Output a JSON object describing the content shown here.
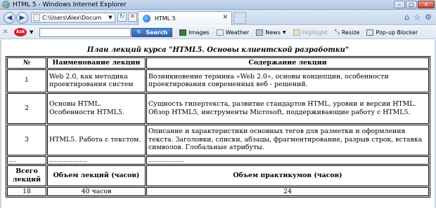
{
  "window": {
    "title": "HTML 5 - Windows Internet Explorer",
    "controls": {
      "minimize": "–",
      "maximize": "□",
      "close": "✕"
    }
  },
  "navbar": {
    "address": "C:\\Users\\Alex\\Docum",
    "tab_label": "HTML 5"
  },
  "toolbar": {
    "logo": "Ask",
    "search_button": "Search",
    "items": [
      {
        "label": "Images",
        "icon": "images-icon"
      },
      {
        "label": "Weather",
        "icon": "weather-icon"
      },
      {
        "label": "News",
        "icon": "news-icon"
      },
      {
        "label": "Highlight",
        "icon": "highlight-icon"
      },
      {
        "label": "Resize",
        "icon": "resize-icon"
      },
      {
        "label": "Pop-up Blocker",
        "icon": "popup-blocker-icon"
      }
    ]
  },
  "document": {
    "caption": "План лекций курса \"HTML5. Основы клиентской разработки\"",
    "headers": {
      "num": "№",
      "name": "Наименование лекции",
      "desc": "Содержание лекции"
    },
    "rows": [
      {
        "num": "1",
        "name": "Web 2.0, как методика проектирования систем",
        "desc": "Возникновение термина «Web 2.0», основы концепции, особенности проектирования современных веб - решений."
      },
      {
        "num": "2",
        "name": "Основы HTML. Особенности HTML5.",
        "desc": "Сущность гипертекста, развитие стандартов HTML, уровни и версии HTML. Обзор HTML5, инструменты Microsoft, поддерживающие работу с HTML5."
      },
      {
        "num": "3",
        "name": "HTML5. Работа с текстом.",
        "desc": "Описание и характеристики основных тегов для разметки и оформления текста. Заголовки, списки, абзацы, фрагментирование, разрыв строк, вставка символов. Глобальные атрибуты."
      }
    ],
    "dots_row": {
      "num": "....",
      "name": ".....................",
      "desc": "...................."
    },
    "footer_headers": {
      "total": "Всего лекций",
      "lecture_hours": "Объем лекций (часов)",
      "practice_hours": "Объем практикумов (часов)"
    },
    "footer_values": {
      "total": "18",
      "lecture_hours": "40 часов",
      "practice_hours": "24"
    }
  }
}
